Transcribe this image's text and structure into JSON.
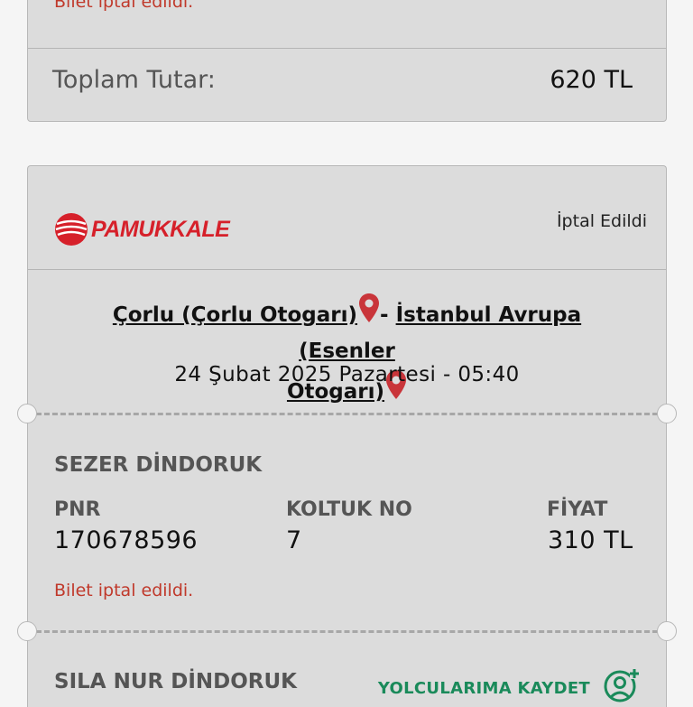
{
  "previous_ticket": {
    "cancel_message": "Bilet iptal edildi.",
    "total_label": "Toplam Tutar:",
    "total_value": "620 TL"
  },
  "ticket": {
    "company": "PAMUKKALE",
    "status": "İptal Edildi",
    "origin": "Çorlu (Çorlu Otogarı)",
    "separator": "-",
    "destination_line1": "İstanbul Avrupa (Esenler",
    "destination_line2": "Otogarı)",
    "datetime": "24 Şubat 2025 Pazartesi - 05:40",
    "colors": {
      "brand": "#d6202a",
      "cancel": "#c0392b",
      "action": "#1a8a5a"
    },
    "passengers": [
      {
        "name": "SEZER DİNDORUK",
        "pnr_label": "PNR",
        "pnr": "170678596",
        "seat_label": "KOLTUK NO",
        "seat": "7",
        "price_label": "FİYAT",
        "price": "310 TL",
        "cancel_message": "Bilet iptal edildi."
      },
      {
        "name": "SILA NUR DİNDORUK",
        "save_label": "YOLCULARIMA KAYDET",
        "save_icon": "add-person-icon"
      }
    ]
  }
}
